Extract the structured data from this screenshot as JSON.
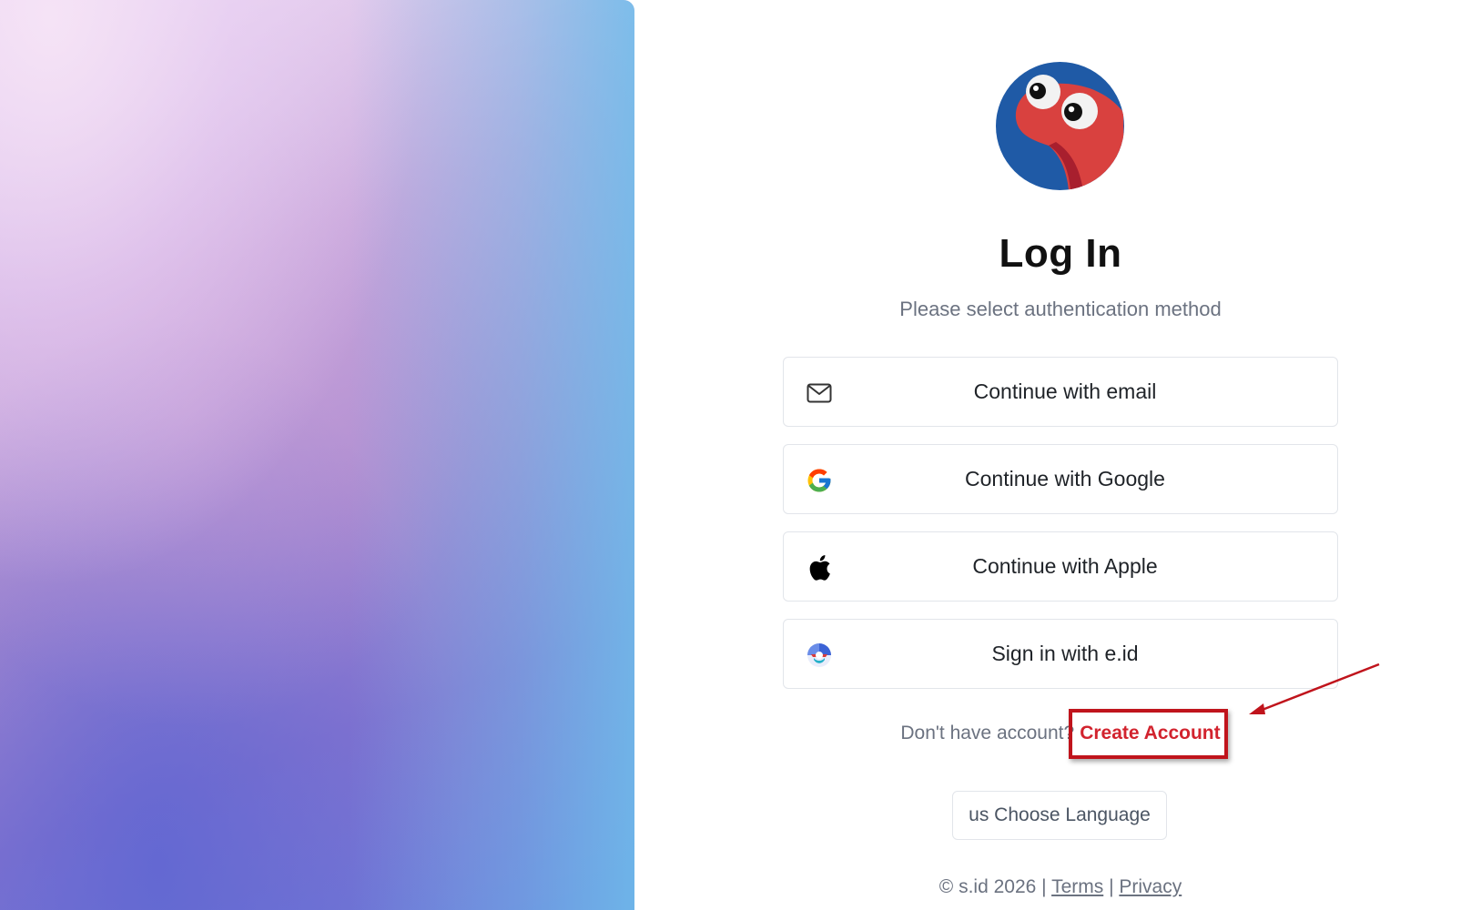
{
  "header": {
    "title": "Log In",
    "subtitle": "Please select authentication method"
  },
  "auth_options": [
    {
      "label": "Continue with email",
      "icon": "mail-icon"
    },
    {
      "label": "Continue with Google",
      "icon": "google-icon"
    },
    {
      "label": "Continue with Apple",
      "icon": "apple-icon"
    },
    {
      "label": "Sign in with e.id",
      "icon": "eid-icon"
    }
  ],
  "signup": {
    "prompt": "Don't have account?",
    "link_label": "Create Account"
  },
  "language_button": {
    "label": "us Choose Language"
  },
  "footer": {
    "copyright": "© s.id 2026 | ",
    "separator": " | ",
    "terms_label": "Terms",
    "privacy_label": "Privacy"
  },
  "colors": {
    "accent_red": "#d2232e",
    "logo_blue": "#1f5aa6",
    "logo_red": "#d9413f",
    "annotation_red": "#c0141c"
  }
}
